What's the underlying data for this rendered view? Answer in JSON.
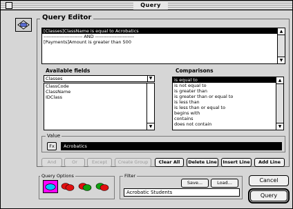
{
  "window": {
    "title": "Query"
  },
  "editor": {
    "heading": "Query Editor",
    "criteria": [
      {
        "text": "[Classes]ClassName is equal to Acrobatics",
        "selected": true
      },
      {
        "text": "------------------------ AND ------------------------",
        "selected": false
      },
      {
        "text": "[Payments]Amount is greater than 500",
        "selected": false
      }
    ]
  },
  "fields": {
    "heading": "Available fields",
    "table": "Classes",
    "items": [
      "ClassCode",
      "ClassName",
      "IDClass"
    ]
  },
  "comparisons": {
    "heading": "Comparisons",
    "items": [
      {
        "text": "is equal to",
        "selected": true
      },
      {
        "text": "is not equal to",
        "selected": false
      },
      {
        "text": "is greater than",
        "selected": false
      },
      {
        "text": "is greater than or equal to",
        "selected": false
      },
      {
        "text": "is less than",
        "selected": false
      },
      {
        "text": "is less than or equal to",
        "selected": false
      },
      {
        "text": "begins with",
        "selected": false
      },
      {
        "text": "contains",
        "selected": false
      },
      {
        "text": "does not contain",
        "selected": false
      }
    ]
  },
  "value": {
    "label": "Value",
    "fx": "Fx",
    "current": "Acrobatics"
  },
  "actions": {
    "and": "And",
    "or": "Or",
    "except": "Except",
    "create_group": "Create Group",
    "clear_all": "Clear All",
    "delete_line": "Delete Line",
    "insert_line": "Insert Line",
    "add_line": "Add Line"
  },
  "query_options": {
    "label": "Query Options"
  },
  "filter": {
    "label": "Filter",
    "save": "Save...",
    "load": "Load...",
    "current": "Acrobatic Students"
  },
  "dialog": {
    "cancel": "Cancel",
    "query": "Query"
  },
  "colors": {
    "selected_option": "#ff00ff",
    "red": "#e01010",
    "green": "#10a010"
  }
}
